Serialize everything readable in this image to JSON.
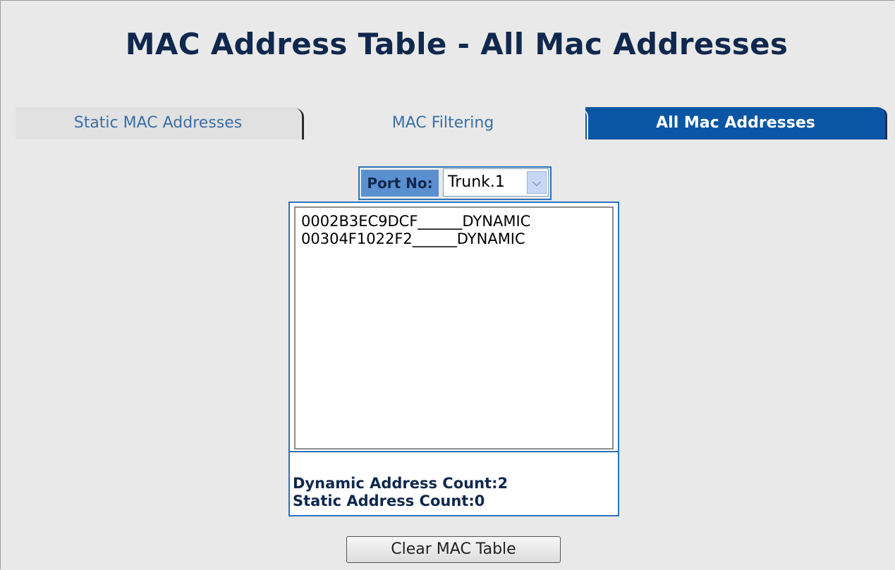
{
  "page": {
    "title": "MAC Address Table - All Mac Addresses"
  },
  "tabs": [
    {
      "label": "Static MAC Addresses",
      "active": false
    },
    {
      "label": "MAC Filtering",
      "active": false
    },
    {
      "label": "All Mac Addresses",
      "active": true
    }
  ],
  "port": {
    "label": "Port No:",
    "selected": "Trunk.1"
  },
  "address_list": [
    "0002B3EC9DCF______DYNAMIC",
    "00304F1022F2______DYNAMIC"
  ],
  "counts": {
    "dynamic": "Dynamic Address Count:2",
    "static": "Static Address Count:0"
  },
  "buttons": {
    "clear_label": "Clear MAC Table"
  },
  "colors": {
    "active_tab": "#0a56a5",
    "title": "#10284d",
    "border_blue": "#2d73bd"
  }
}
